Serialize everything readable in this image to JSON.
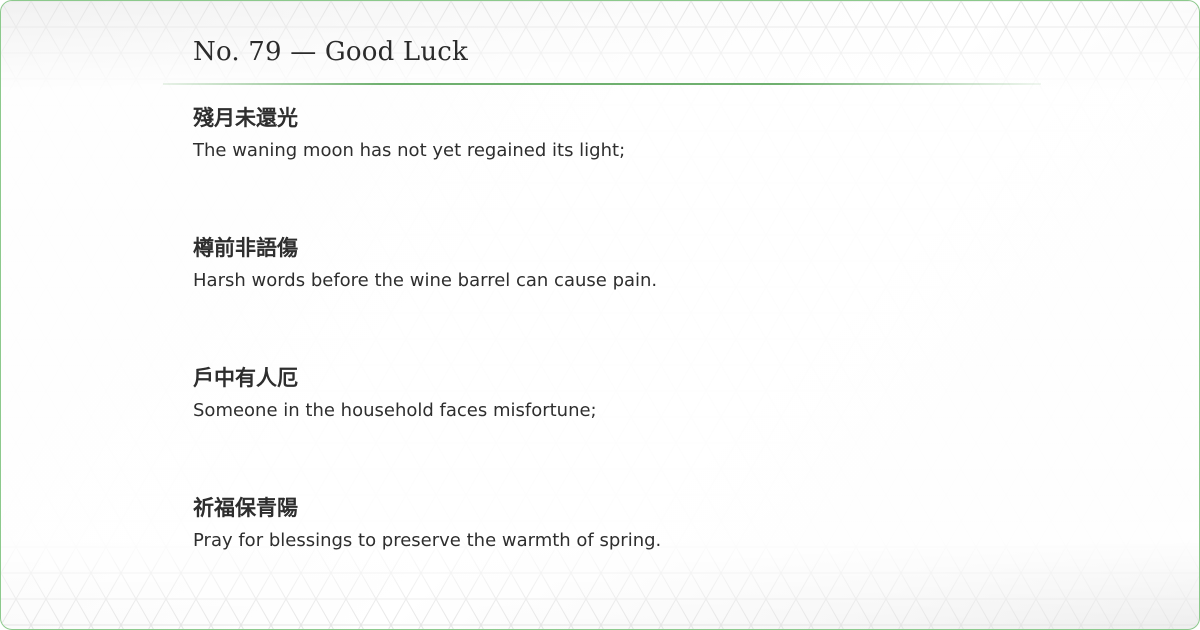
{
  "title": "No. 79 — Good Luck",
  "verses": [
    {
      "chinese": "殘月未還光",
      "english": "The waning moon has not yet regained its light;"
    },
    {
      "chinese": "樽前非語傷",
      "english": "Harsh words before the wine barrel can cause pain."
    },
    {
      "chinese": "戶中有人厄",
      "english": "Someone in the household faces misfortune;"
    },
    {
      "chinese": "祈福保青陽",
      "english": "Pray for blessings to preserve the warmth of spring."
    }
  ],
  "colors": {
    "accent": "#6fb06f",
    "border": "#8cc98c",
    "text": "#2e2e2e"
  }
}
